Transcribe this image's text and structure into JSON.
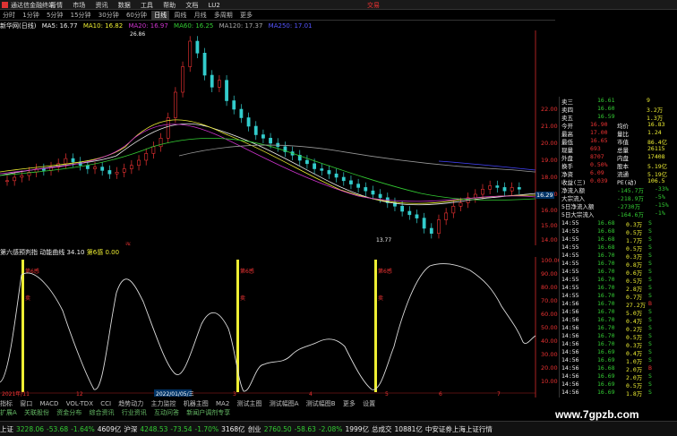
{
  "titlebar": {
    "app_title": "通达信金融终端",
    "menu": [
      "行情",
      "市场",
      "资讯",
      "数据",
      "工具",
      "帮助",
      "文档",
      "LU2"
    ],
    "trade_label": "交易"
  },
  "tabs": [
    "分时",
    "1分钟",
    "5分钟",
    "15分钟",
    "30分钟",
    "60分钟",
    "日线",
    "周线",
    "月线",
    "多周期",
    "更多"
  ],
  "ma_row": {
    "name": "新华网(日线)",
    "ma5": "MA5: 16.77",
    "ma10": "MA10: 16.82",
    "ma20": "MA20: 16.97",
    "ma60": "MA60: 16.25",
    "ma120": "MA120: 17.37",
    "ma250": "MA250: 17.01"
  },
  "main_chart": {
    "y_ticks": [
      "22.00",
      "21.00",
      "20.00",
      "19.00",
      "18.00",
      "17.00",
      "16.00",
      "15.00",
      "14.00"
    ],
    "high_label": "26.86",
    "low_label": "13.77",
    "last_price": "16.29",
    "marker_labels": [
      "涨",
      "跌"
    ]
  },
  "indicator_row": {
    "name": "第六感预判指",
    "dyn_label": "动能曲线",
    "dyn_value": "34.10",
    "ind_label": "第6感",
    "ind_value": "0.00"
  },
  "ind_chart": {
    "y_ticks": [
      "100.00",
      "90.00",
      "80.00",
      "70.00",
      "60.00",
      "50.00",
      "40.00",
      "30.00",
      "20.00",
      "10.00"
    ],
    "bar_labels": [
      "第6感",
      "第6感",
      "第6感"
    ],
    "sell_labels": [
      "卖",
      "卖",
      "卖"
    ],
    "x_labels": [
      "2021年/11",
      "12",
      "2022/01/05/三",
      "3",
      "4",
      "5",
      "6",
      "7"
    ]
  },
  "quote_panel": {
    "asks": [
      {
        "label": "卖三",
        "price": "16.61",
        "vol": "9"
      },
      {
        "label": "卖四",
        "price": "16.60",
        "vol": "3.2万"
      },
      {
        "label": "卖五",
        "price": "16.59",
        "vol": "1.3万"
      }
    ],
    "stats": [
      {
        "l1": "今开",
        "v1": "16.90",
        "l2": "均价",
        "v2": "16.83"
      },
      {
        "l1": "最高",
        "v1": "17.00",
        "l2": "量比",
        "v2": "1.24"
      },
      {
        "l1": "最低",
        "v1": "16.65",
        "l2": "市值",
        "v2": "86.4亿"
      },
      {
        "l1": "现量",
        "v1": "693",
        "l2": "总量",
        "v2": "26115"
      },
      {
        "l1": "外盘",
        "v1": "8707",
        "l2": "内盘",
        "v2": "17408"
      },
      {
        "l1": "换手",
        "v1": "0.50%",
        "l2": "股本",
        "v2": "5.19亿"
      },
      {
        "l1": "净资",
        "v1": "6.09",
        "l2": "流通",
        "v2": "5.19亿"
      },
      {
        "l1": "收益(三)",
        "v1": "0.039",
        "l2": "PE(动)",
        "v2": "106.5"
      }
    ],
    "flows": [
      {
        "label": "净流入额",
        "value": "-145.7万",
        "pct": "-33%"
      },
      {
        "label": "大宗流入",
        "value": "-218.9万",
        "pct": "-5%"
      },
      {
        "label": "5日净流入额",
        "value": "-2730万",
        "pct": "-15%"
      },
      {
        "label": "5日大宗流入",
        "value": "-164.6万",
        "pct": "-1%"
      }
    ],
    "ticks": [
      {
        "time": "14:55",
        "price": "16.68",
        "vol": "0.3万",
        "dir": "S"
      },
      {
        "time": "14:55",
        "price": "16.68",
        "vol": "0.5万",
        "dir": "S"
      },
      {
        "time": "14:55",
        "price": "16.68",
        "vol": "1.7万",
        "dir": "S"
      },
      {
        "time": "14:55",
        "price": "16.68",
        "vol": "0.5万",
        "dir": "S"
      },
      {
        "time": "14:55",
        "price": "16.70",
        "vol": "0.3万",
        "dir": "S"
      },
      {
        "time": "14:55",
        "price": "16.70",
        "vol": "0.8万",
        "dir": "S"
      },
      {
        "time": "14:55",
        "price": "16.70",
        "vol": "0.6万",
        "dir": "S"
      },
      {
        "time": "14:55",
        "price": "16.70",
        "vol": "0.5万",
        "dir": "S"
      },
      {
        "time": "14:55",
        "price": "16.70",
        "vol": "2.8万",
        "dir": "S"
      },
      {
        "time": "14:55",
        "price": "16.70",
        "vol": "0.7万",
        "dir": "S"
      },
      {
        "time": "14:56",
        "price": "16.70",
        "vol": "27.2万",
        "dir": "B"
      },
      {
        "time": "14:56",
        "price": "16.70",
        "vol": "5.0万",
        "dir": "S"
      },
      {
        "time": "14:56",
        "price": "16.70",
        "vol": "0.4万",
        "dir": "S"
      },
      {
        "time": "14:56",
        "price": "16.70",
        "vol": "0.2万",
        "dir": "S"
      },
      {
        "time": "14:56",
        "price": "16.70",
        "vol": "0.5万",
        "dir": "S"
      },
      {
        "time": "14:56",
        "price": "16.70",
        "vol": "0.3万",
        "dir": "S"
      },
      {
        "time": "14:56",
        "price": "16.69",
        "vol": "0.4万",
        "dir": "S"
      },
      {
        "time": "14:56",
        "price": "16.69",
        "vol": "1.0万",
        "dir": "S"
      },
      {
        "time": "14:56",
        "price": "16.68",
        "vol": "2.0万",
        "dir": "B"
      },
      {
        "time": "14:56",
        "price": "16.69",
        "vol": "2.0万",
        "dir": "S"
      },
      {
        "time": "14:56",
        "price": "16.69",
        "vol": "0.5万",
        "dir": "S"
      },
      {
        "time": "14:56",
        "price": "16.69",
        "vol": "1.8万",
        "dir": "S"
      }
    ]
  },
  "bottom_tabs": [
    "指标",
    "窗口",
    "MACD",
    "VOL-TDX",
    "CCI",
    "趋势动力",
    "主力监控",
    "机器主图",
    "MA2",
    "测试主图",
    "测试幅图A",
    "测试幅图B",
    "更多",
    "设置"
  ],
  "bottom_tabs2": [
    "扩展A",
    "关联股份",
    "资金分布",
    "综合资讯",
    "行业资讯",
    "互动问答",
    "新闻户调剂专享"
  ],
  "statusbar": [
    {
      "text": "上证",
      "cls": "white"
    },
    {
      "text": "3228.06",
      "cls": "green"
    },
    {
      "text": "-53.68",
      "cls": "green"
    },
    {
      "text": "-1.64%",
      "cls": "green"
    },
    {
      "text": "4609亿",
      "cls": "white"
    },
    {
      "text": "沪深",
      "cls": "white"
    },
    {
      "text": "4248.53",
      "cls": "green"
    },
    {
      "text": "-73.54",
      "cls": "green"
    },
    {
      "text": "-1.70%",
      "cls": "green"
    },
    {
      "text": "3168亿",
      "cls": "white"
    },
    {
      "text": "创业",
      "cls": "white"
    },
    {
      "text": "2760.50",
      "cls": "green"
    },
    {
      "text": "-58.63",
      "cls": "green"
    },
    {
      "text": "-2.08%",
      "cls": "green"
    },
    {
      "text": "1999亿",
      "cls": "white"
    },
    {
      "text": "总成交",
      "cls": "white"
    },
    {
      "text": "10881亿",
      "cls": "white"
    },
    {
      "text": "中安证券上海上证行情",
      "cls": "white"
    }
  ],
  "watermark": "www.7gpzb.com",
  "colors": {
    "up": "#ee3333",
    "down": "#33cc33",
    "ma5": "#ffffff",
    "ma10": "#eeee33",
    "ma20": "#cc33cc",
    "ma60": "#33cc33",
    "ma120": "#888888",
    "ma250": "#3333ff"
  }
}
